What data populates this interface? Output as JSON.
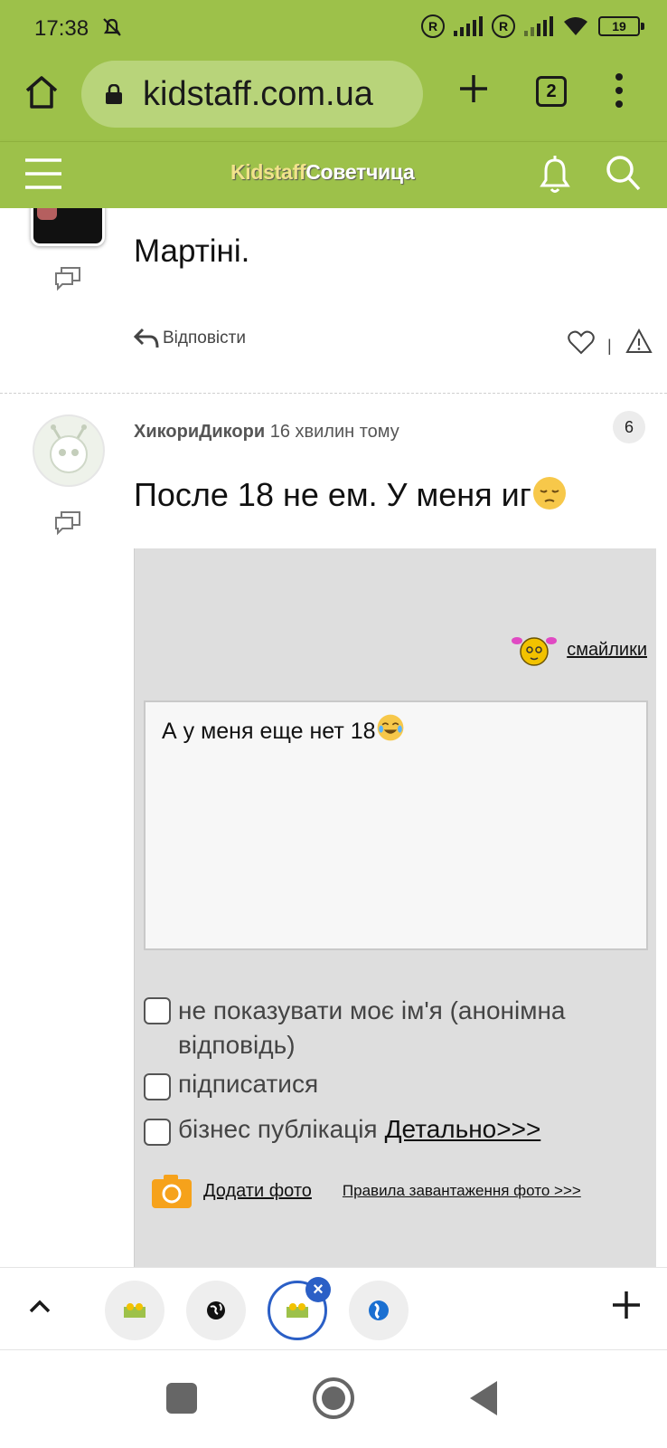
{
  "status_bar": {
    "time": "17:38",
    "battery": "19"
  },
  "browser": {
    "url": "kidstaff.com.ua",
    "tab_count": "2"
  },
  "site_header": {
    "brand_part1": "Kidstaff",
    "brand_part2": "Советчица"
  },
  "post1": {
    "text": "Мартіні.",
    "reply_label": "Відповісти",
    "separator": "|"
  },
  "post2": {
    "author": "ХикориДикори",
    "time_ago": "16 хвилин тому",
    "count_badge": "6",
    "text": "После 18 не ем. У меня иг",
    "emoji": "pensive-face-emoji"
  },
  "reply_form": {
    "smileys_link": "смайлики",
    "textarea_value": "А у меня еще нет 18",
    "textarea_emoji": "tears-of-joy-emoji",
    "checkbox_anonymous": "не показувати моє ім'я (анонімна відповідь)",
    "checkbox_subscribe": "підписатися",
    "checkbox_business": "бізнес публікація",
    "details_link": "Детально>>>",
    "add_photo_link": "Додати фото",
    "photo_rules_link": "Правила завантаження фото >>>"
  },
  "colors": {
    "brand_green": "#9dc14a",
    "active_tab_blue": "#2b5fc6",
    "form_bg": "#dedede"
  }
}
